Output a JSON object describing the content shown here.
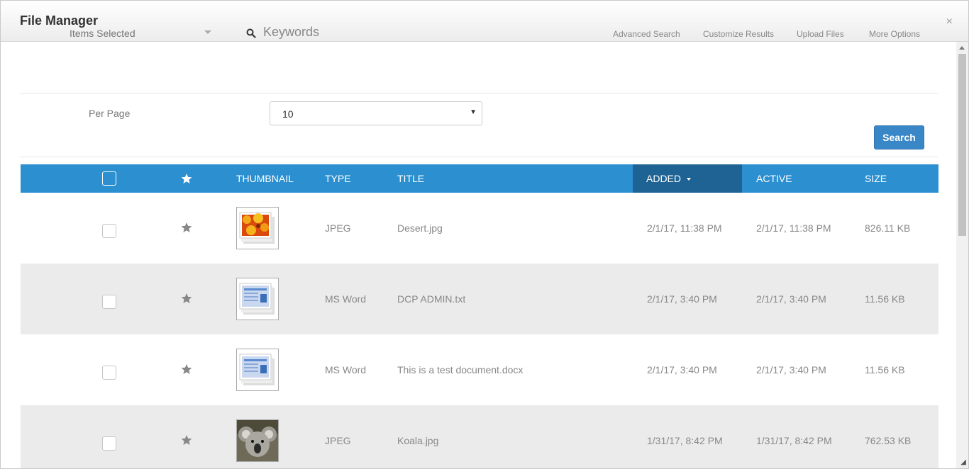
{
  "modal": {
    "title": "File Manager",
    "close_glyph": "×"
  },
  "toolbar": {
    "items_selected": "Items Selected",
    "keywords_placeholder": "Keywords",
    "links": {
      "advanced_search": "Advanced Search",
      "customize_results": "Customize Results",
      "upload_files": "Upload Files",
      "more_options": "More Options"
    }
  },
  "per_page": {
    "label": "Per Page",
    "value": "10"
  },
  "search_button": "Search",
  "table": {
    "columns": {
      "thumbnail": "THUMBNAIL",
      "type": "TYPE",
      "title": "TITLE",
      "added": "ADDED",
      "active": "ACTIVE",
      "size": "SIZE"
    },
    "sorted_by": "added",
    "rows": [
      {
        "type": "JPEG",
        "title": "Desert.jpg",
        "added": "2/1/17, 11:38 PM",
        "active": "2/1/17, 11:38 PM",
        "size": "826.11 KB",
        "thumb": "flower-image-thumbnail"
      },
      {
        "type": "MS Word",
        "title": "DCP ADMIN.txt",
        "added": "2/1/17, 3:40 PM",
        "active": "2/1/17, 3:40 PM",
        "size": "11.56 KB",
        "thumb": "document-thumbnail"
      },
      {
        "type": "MS Word",
        "title": "This is a test document.docx",
        "added": "2/1/17, 3:40 PM",
        "active": "2/1/17, 3:40 PM",
        "size": "11.56 KB",
        "thumb": "document-thumbnail"
      },
      {
        "type": "JPEG",
        "title": "Koala.jpg",
        "added": "1/31/17, 8:42 PM",
        "active": "1/31/17, 8:42 PM",
        "size": "762.53 KB",
        "thumb": "koala-image-thumbnail"
      }
    ]
  },
  "colors": {
    "header_bar": "#2b8fd0",
    "sorted_column": "#1e6393",
    "primary_button": "#3a87c8",
    "alt_row": "#ebebeb"
  }
}
